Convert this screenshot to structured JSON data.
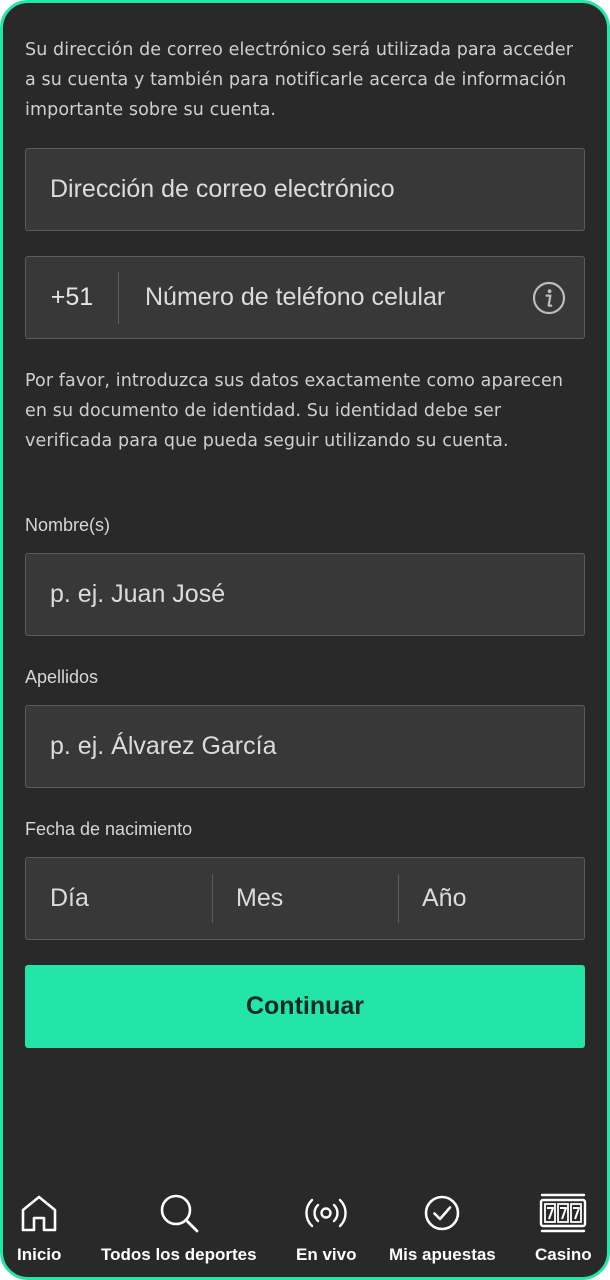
{
  "intro_text": "Su dirección de correo electrónico será utilizada para acceder a su cuenta y también para notificarle acerca de información importante sobre su cuenta.",
  "email": {
    "placeholder": "Dirección de correo electrónico",
    "value": ""
  },
  "phone": {
    "prefix": "+51",
    "placeholder": "Número de teléfono celular",
    "value": "",
    "icon": "info-icon"
  },
  "identity_text": "Por favor, introduzca sus datos exactamente como aparecen en su documento de identidad. Su identidad debe ser verificada para que pueda seguir utilizando su cuenta.",
  "first_name": {
    "label": "Nombre(s)",
    "placeholder": "p. ej. Juan José",
    "value": ""
  },
  "last_name": {
    "label": "Apellidos",
    "placeholder": "p. ej. Álvarez García",
    "value": ""
  },
  "birth_date": {
    "label": "Fecha de nacimiento",
    "day_placeholder": "Día",
    "month_placeholder": "Mes",
    "year_placeholder": "Año"
  },
  "continue_button": "Continuar",
  "colors": {
    "accent": "#23e5a8",
    "background": "#292929",
    "field": "#383838"
  },
  "nav": [
    {
      "label": "Inicio",
      "icon": "home-icon"
    },
    {
      "label": "Todos los deportes",
      "icon": "search-icon"
    },
    {
      "label": "En vivo",
      "icon": "live-broadcast-icon"
    },
    {
      "label": "Mis apuestas",
      "icon": "check-circle-icon"
    },
    {
      "label": "Casino",
      "icon": "slot-machine-icon"
    }
  ]
}
